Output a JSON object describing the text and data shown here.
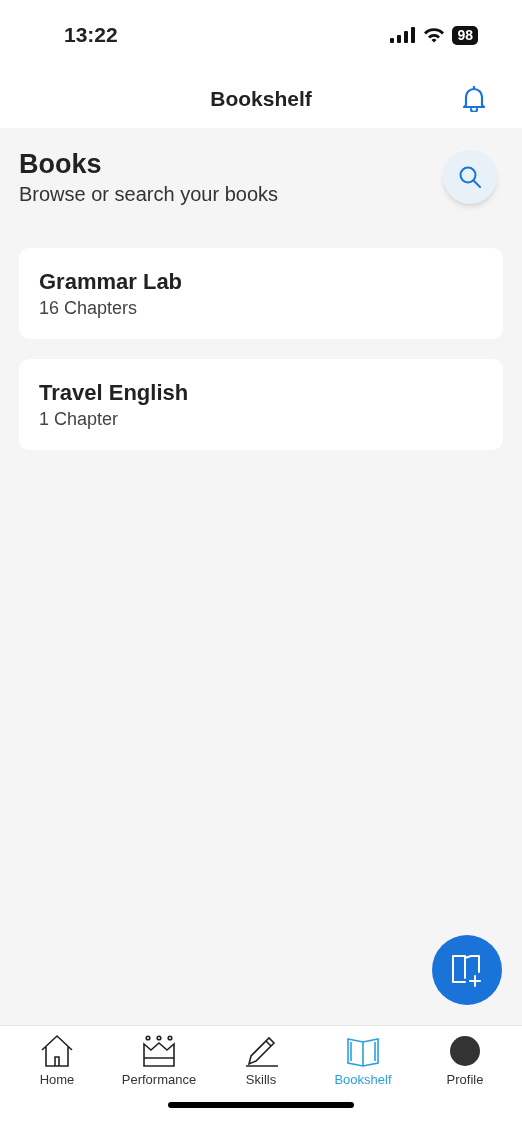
{
  "status_bar": {
    "time": "13:22",
    "battery": "98"
  },
  "header": {
    "title": "Bookshelf"
  },
  "section": {
    "title": "Books",
    "subtitle": "Browse or search your books"
  },
  "books": [
    {
      "title": "Grammar Lab",
      "chapters": "16 Chapters"
    },
    {
      "title": "Travel English",
      "chapters": "1 Chapter"
    }
  ],
  "tabs": [
    {
      "kind": "home",
      "label": "Home",
      "selected": false
    },
    {
      "kind": "performance",
      "label": "Performance",
      "selected": false
    },
    {
      "kind": "skills",
      "label": "Skills",
      "selected": false
    },
    {
      "kind": "bookshelf",
      "label": "Bookshelf",
      "selected": true
    },
    {
      "kind": "profile",
      "label": "Profile",
      "selected": false
    }
  ]
}
